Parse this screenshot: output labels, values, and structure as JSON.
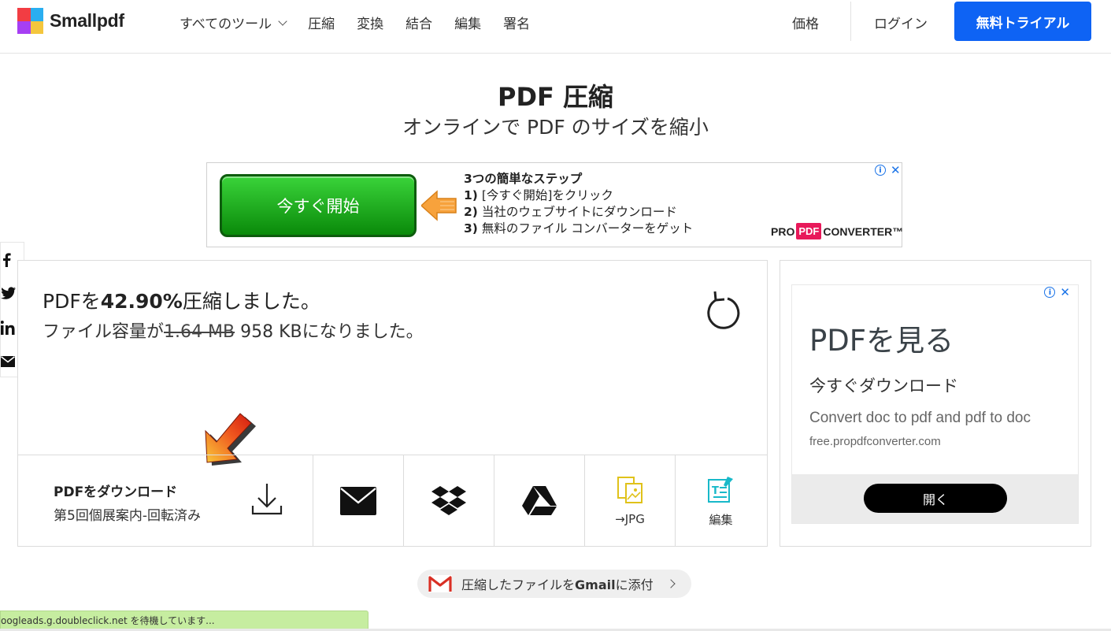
{
  "header": {
    "brand": "Smallpdf",
    "nav": [
      "すべてのツール",
      "圧縮",
      "変換",
      "結合",
      "編集",
      "署名"
    ],
    "price": "価格",
    "login": "ログイン",
    "trial": "無料トライアル"
  },
  "page": {
    "title": "PDF 圧縮",
    "subtitle": "オンラインで PDF のサイズを縮小"
  },
  "ad_top": {
    "button": "今すぐ開始",
    "steps_title": "3つの簡単なステップ",
    "step1_num": "1)",
    "step1": "[今すぐ開始]をクリック",
    "step2_num": "2)",
    "step2": "当社のウェブサイトにダウンロード",
    "step3_num": "3)",
    "step3": "無料のファイル コンバーターをゲット",
    "brand_pro": "PRO",
    "brand_pdf": "PDF",
    "brand_conv": "CONVERTER™"
  },
  "result": {
    "line1_pre": "PDFを",
    "percent": "42.90%",
    "line1_post": "圧縮しました。",
    "line2_pre": "ファイル容量が",
    "old_size": "1.64 MB",
    "new_size": "958 KB",
    "line2_post": "になりました。"
  },
  "actions": {
    "download_title": "PDFをダウンロード",
    "file_name": "第5回個展案内-回転済み",
    "to_jpg": "→JPG",
    "edit": "編集"
  },
  "ad_side": {
    "title": "PDFを見る",
    "subtitle": "今すぐダウンロード",
    "desc": "Convert doc to pdf and pdf to doc",
    "url": "free.propdfconverter.com",
    "button": "開く"
  },
  "gmail": {
    "pre": "圧縮したファイルを",
    "bold": "Gmail",
    "post": "に添付"
  },
  "status_bar": "oogleads.g.doubleclick.net を待機しています..."
}
